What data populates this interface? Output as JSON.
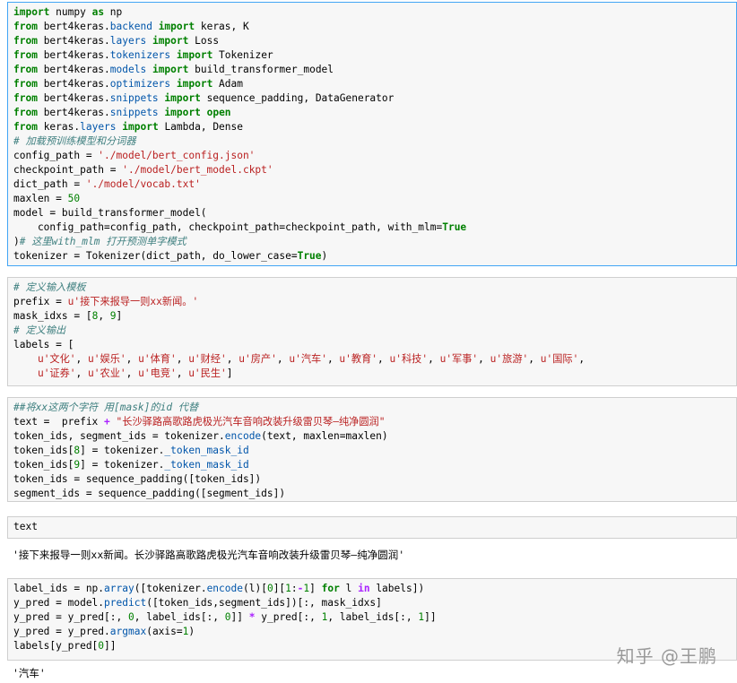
{
  "cells": [
    {
      "kind": "code",
      "selected": true,
      "lines": [
        [
          [
            "kw",
            "import"
          ],
          [
            "t",
            " numpy "
          ],
          [
            "kw",
            "as"
          ],
          [
            "t",
            " np"
          ]
        ],
        [
          [
            "kw",
            "from"
          ],
          [
            "t",
            " bert4keras."
          ],
          [
            "mod",
            "backend"
          ],
          [
            "t",
            " "
          ],
          [
            "kw",
            "import"
          ],
          [
            "t",
            " keras, K"
          ]
        ],
        [
          [
            "kw",
            "from"
          ],
          [
            "t",
            " bert4keras."
          ],
          [
            "mod",
            "layers"
          ],
          [
            "t",
            " "
          ],
          [
            "kw",
            "import"
          ],
          [
            "t",
            " Loss"
          ]
        ],
        [
          [
            "kw",
            "from"
          ],
          [
            "t",
            " bert4keras."
          ],
          [
            "mod",
            "tokenizers"
          ],
          [
            "t",
            " "
          ],
          [
            "kw",
            "import"
          ],
          [
            "t",
            " Tokenizer"
          ]
        ],
        [
          [
            "kw",
            "from"
          ],
          [
            "t",
            " bert4keras."
          ],
          [
            "mod",
            "models"
          ],
          [
            "t",
            " "
          ],
          [
            "kw",
            "import"
          ],
          [
            "t",
            " build_transformer_model"
          ]
        ],
        [
          [
            "kw",
            "from"
          ],
          [
            "t",
            " bert4keras."
          ],
          [
            "mod",
            "optimizers"
          ],
          [
            "t",
            " "
          ],
          [
            "kw",
            "import"
          ],
          [
            "t",
            " Adam"
          ]
        ],
        [
          [
            "kw",
            "from"
          ],
          [
            "t",
            " bert4keras."
          ],
          [
            "mod",
            "snippets"
          ],
          [
            "t",
            " "
          ],
          [
            "kw",
            "import"
          ],
          [
            "t",
            " sequence_padding, DataGenerator"
          ]
        ],
        [
          [
            "kw",
            "from"
          ],
          [
            "t",
            " bert4keras."
          ],
          [
            "mod",
            "snippets"
          ],
          [
            "t",
            " "
          ],
          [
            "kw",
            "import"
          ],
          [
            "t",
            " "
          ],
          [
            "kw",
            "open"
          ]
        ],
        [
          [
            "kw",
            "from"
          ],
          [
            "t",
            " keras."
          ],
          [
            "mod",
            "layers"
          ],
          [
            "t",
            " "
          ],
          [
            "kw",
            "import"
          ],
          [
            "t",
            " Lambda, Dense"
          ]
        ],
        [
          [
            "cmt",
            "# 加载预训练模型和分词器"
          ]
        ],
        [
          [
            "t",
            "config_path = "
          ],
          [
            "str",
            "'./model/bert_config.json'"
          ]
        ],
        [
          [
            "t",
            "checkpoint_path = "
          ],
          [
            "str",
            "'./model/bert_model.ckpt'"
          ]
        ],
        [
          [
            "t",
            "dict_path = "
          ],
          [
            "str",
            "'./model/vocab.txt'"
          ]
        ],
        [
          [
            "t",
            "maxlen = "
          ],
          [
            "num",
            "50"
          ]
        ],
        [
          [
            "t",
            "model = build_transformer_model("
          ]
        ],
        [
          [
            "t",
            "    config_path=config_path, checkpoint_path=checkpoint_path, with_mlm="
          ],
          [
            "kw",
            "True"
          ]
        ],
        [
          [
            "t",
            ")"
          ],
          [
            "cmt",
            "# 这里with_mlm 打开预测单字模式"
          ]
        ],
        [
          [
            "t",
            "tokenizer = Tokenizer(dict_path, do_lower_case="
          ],
          [
            "kw",
            "True"
          ],
          [
            "t",
            ")"
          ]
        ]
      ]
    },
    {
      "kind": "code",
      "selected": false,
      "lines": [
        [
          [
            "cmt",
            "# 定义输入模板"
          ]
        ],
        [
          [
            "t",
            "prefix = "
          ],
          [
            "str",
            "u'接下来报导一则xx新闻。'"
          ]
        ],
        [
          [
            "t",
            "mask_idxs = ["
          ],
          [
            "num",
            "8"
          ],
          [
            "t",
            ", "
          ],
          [
            "num",
            "9"
          ],
          [
            "t",
            "]"
          ]
        ],
        [
          [
            "cmt",
            "# 定义输出"
          ]
        ],
        [
          [
            "t",
            "labels = ["
          ]
        ],
        [
          [
            "t",
            "    "
          ],
          [
            "str",
            "u'文化'"
          ],
          [
            "t",
            ", "
          ],
          [
            "str",
            "u'娱乐'"
          ],
          [
            "t",
            ", "
          ],
          [
            "str",
            "u'体育'"
          ],
          [
            "t",
            ", "
          ],
          [
            "str",
            "u'财经'"
          ],
          [
            "t",
            ", "
          ],
          [
            "str",
            "u'房产'"
          ],
          [
            "t",
            ", "
          ],
          [
            "str",
            "u'汽车'"
          ],
          [
            "t",
            ", "
          ],
          [
            "str",
            "u'教育'"
          ],
          [
            "t",
            ", "
          ],
          [
            "str",
            "u'科技'"
          ],
          [
            "t",
            ", "
          ],
          [
            "str",
            "u'军事'"
          ],
          [
            "t",
            ", "
          ],
          [
            "str",
            "u'旅游'"
          ],
          [
            "t",
            ", "
          ],
          [
            "str",
            "u'国际'"
          ],
          [
            "t",
            ","
          ]
        ],
        [
          [
            "t",
            "    "
          ],
          [
            "str",
            "u'证券'"
          ],
          [
            "t",
            ", "
          ],
          [
            "str",
            "u'农业'"
          ],
          [
            "t",
            ", "
          ],
          [
            "str",
            "u'电竞'"
          ],
          [
            "t",
            ", "
          ],
          [
            "str",
            "u'民生'"
          ],
          [
            "t",
            "]"
          ]
        ]
      ]
    },
    {
      "kind": "code",
      "selected": false,
      "lines": [
        [
          [
            "cmt",
            "##将xx这两个字符 用[mask]的id 代替"
          ]
        ],
        [
          [
            "t",
            "text =  prefix "
          ],
          [
            "op",
            "+"
          ],
          [
            "t",
            " "
          ],
          [
            "str",
            "\"长沙驿路高歌路虎极光汽车音响改装升级雷贝琴—纯净圆润\""
          ]
        ],
        [
          [
            "t",
            "token_ids, segment_ids = tokenizer."
          ],
          [
            "mod",
            "encode"
          ],
          [
            "t",
            "(text, maxlen=maxlen)"
          ]
        ],
        [
          [
            "t",
            "token_ids["
          ],
          [
            "num",
            "8"
          ],
          [
            "t",
            "] = tokenizer."
          ],
          [
            "mod",
            "_token_mask_id"
          ]
        ],
        [
          [
            "t",
            "token_ids["
          ],
          [
            "num",
            "9"
          ],
          [
            "t",
            "] = tokenizer."
          ],
          [
            "mod",
            "_token_mask_id"
          ]
        ],
        [
          [
            "t",
            "token_ids = sequence_padding([token_ids])"
          ]
        ],
        [
          [
            "t",
            "segment_ids = sequence_padding([segment_ids])"
          ]
        ]
      ]
    },
    {
      "kind": "code",
      "selected": false,
      "lines": [
        [
          [
            "t",
            "text"
          ]
        ]
      ]
    },
    {
      "kind": "code",
      "selected": false,
      "lines": [
        [
          [
            "t",
            "label_ids = np."
          ],
          [
            "mod",
            "array"
          ],
          [
            "t",
            "([tokenizer."
          ],
          [
            "mod",
            "encode"
          ],
          [
            "t",
            "(l)["
          ],
          [
            "num",
            "0"
          ],
          [
            "t",
            "]["
          ],
          [
            "num",
            "1"
          ],
          [
            "t",
            ":"
          ],
          [
            "op",
            "-"
          ],
          [
            "num",
            "1"
          ],
          [
            "t",
            "] "
          ],
          [
            "kw",
            "for"
          ],
          [
            "t",
            " l "
          ],
          [
            "op",
            "in"
          ],
          [
            "t",
            " labels])"
          ]
        ],
        [
          [
            "t",
            "y_pred = model."
          ],
          [
            "mod",
            "predict"
          ],
          [
            "t",
            "([token_ids,segment_ids])[:, mask_idxs]"
          ]
        ],
        [
          [
            "t",
            "y_pred = y_pred[:, "
          ],
          [
            "num",
            "0"
          ],
          [
            "t",
            ", label_ids[:, "
          ],
          [
            "num",
            "0"
          ],
          [
            "t",
            "]] "
          ],
          [
            "op",
            "*"
          ],
          [
            "t",
            " y_pred[:, "
          ],
          [
            "num",
            "1"
          ],
          [
            "t",
            ", label_ids[:, "
          ],
          [
            "num",
            "1"
          ],
          [
            "t",
            "]]"
          ]
        ],
        [
          [
            "t",
            "y_pred = y_pred."
          ],
          [
            "mod",
            "argmax"
          ],
          [
            "t",
            "(axis="
          ],
          [
            "num",
            "1"
          ],
          [
            "t",
            ")"
          ]
        ],
        [
          [
            "t",
            "labels[y_pred["
          ],
          [
            "num",
            "0"
          ],
          [
            "t",
            "]]"
          ]
        ]
      ]
    }
  ],
  "outputs": {
    "text_output": "'接下来报导一则xx新闻。长沙驿路高歌路虎极光汽车音响改装升级雷贝琴—纯净圆润'",
    "label_output": "'汽车'"
  },
  "watermark": "知乎 @王鹏"
}
